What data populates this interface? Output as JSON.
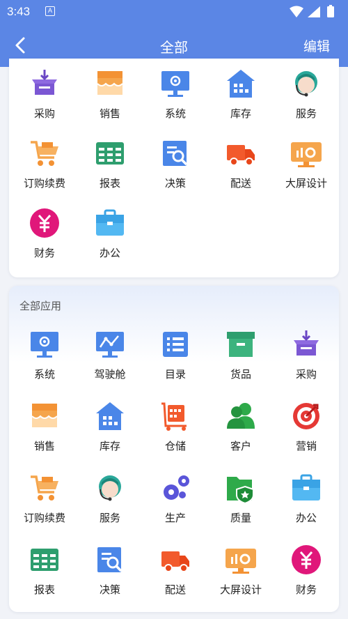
{
  "status_bar": {
    "time": "3:43",
    "notification_icon": "A"
  },
  "header": {
    "title": "全部",
    "edit_label": "编辑",
    "back_icon": "chevron-left-icon"
  },
  "colors": {
    "header_bg": "#5b86e5",
    "page_bg": "#f1f3f8"
  },
  "favorites": {
    "items": [
      {
        "label": "采购",
        "icon": "purchase"
      },
      {
        "label": "销售",
        "icon": "sales"
      },
      {
        "label": "系统",
        "icon": "system"
      },
      {
        "label": "库存",
        "icon": "inventory"
      },
      {
        "label": "服务",
        "icon": "service"
      },
      {
        "label": "订购续费",
        "icon": "cart"
      },
      {
        "label": "报表",
        "icon": "report"
      },
      {
        "label": "决策",
        "icon": "decision"
      },
      {
        "label": "配送",
        "icon": "delivery"
      },
      {
        "label": "大屏设计",
        "icon": "screen"
      },
      {
        "label": "财务",
        "icon": "finance"
      },
      {
        "label": "办公",
        "icon": "office"
      }
    ]
  },
  "all_apps": {
    "title": "全部应用",
    "items": [
      {
        "label": "系统",
        "icon": "system"
      },
      {
        "label": "驾驶舱",
        "icon": "cockpit"
      },
      {
        "label": "目录",
        "icon": "catalog"
      },
      {
        "label": "货品",
        "icon": "goods"
      },
      {
        "label": "采购",
        "icon": "purchase"
      },
      {
        "label": "销售",
        "icon": "sales"
      },
      {
        "label": "库存",
        "icon": "inventory"
      },
      {
        "label": "仓储",
        "icon": "warehouse"
      },
      {
        "label": "客户",
        "icon": "customer"
      },
      {
        "label": "营销",
        "icon": "marketing"
      },
      {
        "label": "订购续费",
        "icon": "cart"
      },
      {
        "label": "服务",
        "icon": "service"
      },
      {
        "label": "生产",
        "icon": "production"
      },
      {
        "label": "质量",
        "icon": "quality"
      },
      {
        "label": "办公",
        "icon": "office"
      },
      {
        "label": "报表",
        "icon": "report"
      },
      {
        "label": "决策",
        "icon": "decision"
      },
      {
        "label": "配送",
        "icon": "delivery"
      },
      {
        "label": "大屏设计",
        "icon": "screen"
      },
      {
        "label": "财务",
        "icon": "finance"
      }
    ]
  }
}
